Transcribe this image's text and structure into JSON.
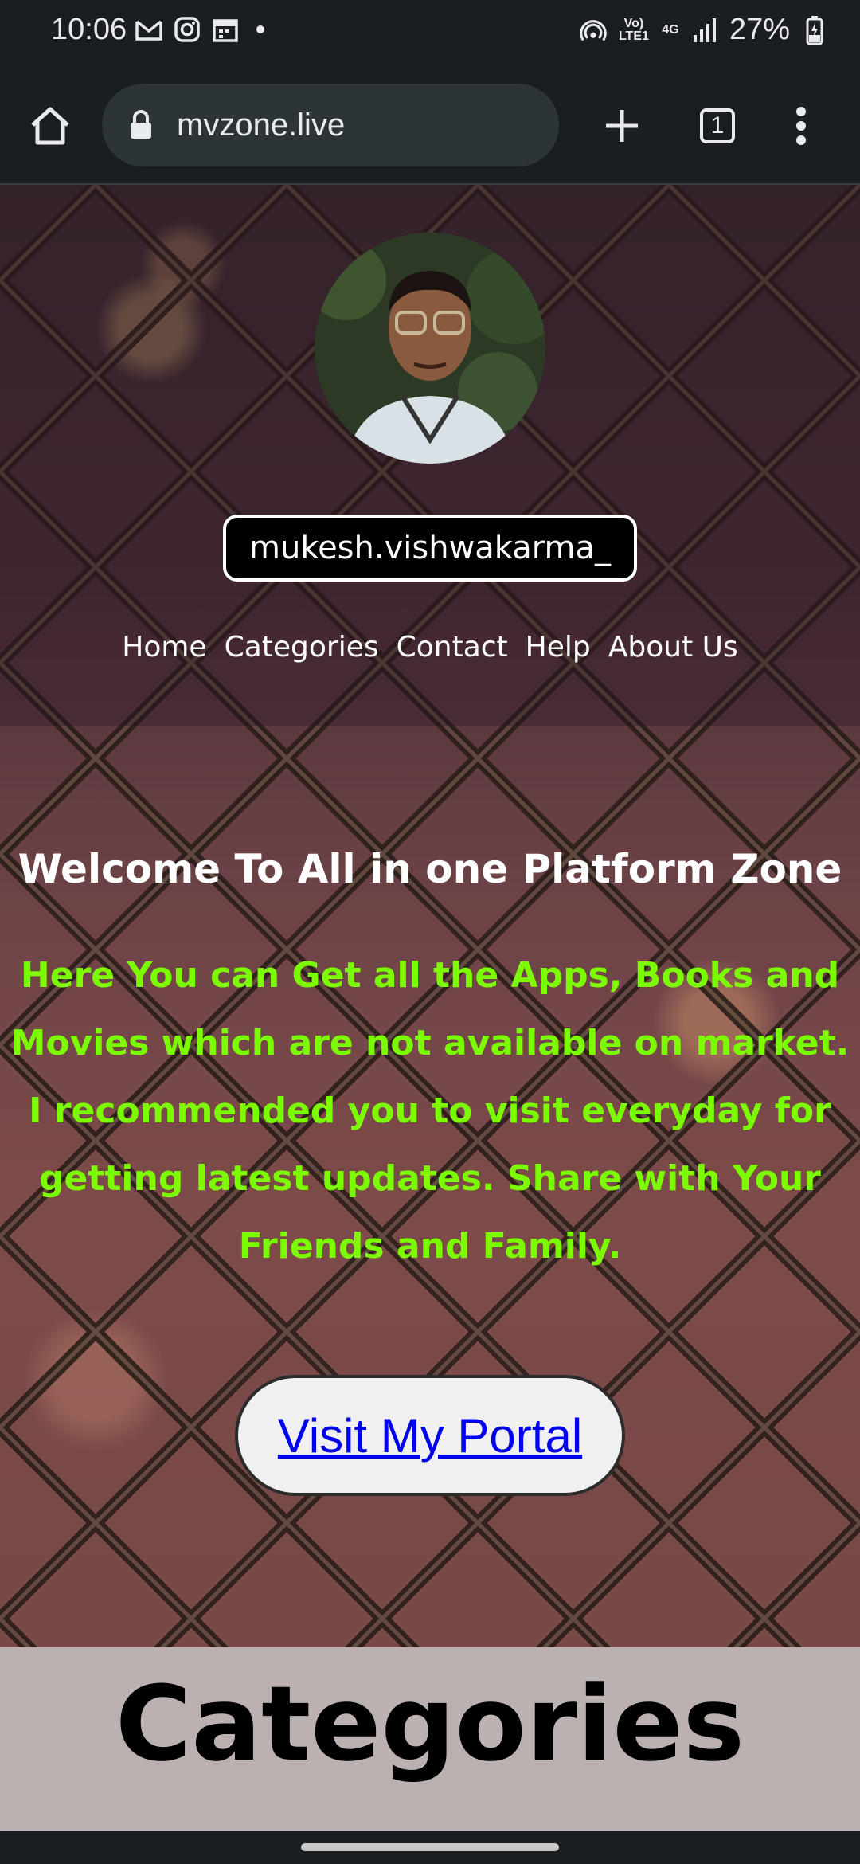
{
  "status_bar": {
    "time": "10:06",
    "battery": "27%",
    "volte_label": "Vo) LTE1",
    "network_label": "4G",
    "left_icons": [
      "gmail-icon",
      "instagram-icon",
      "calendar-icon"
    ],
    "right_icons": [
      "hotspot-icon",
      "volte-icon",
      "network-4g-icon",
      "signal-icon",
      "battery-charging-icon"
    ]
  },
  "browser": {
    "url": "mvzone.live",
    "tab_count": "1"
  },
  "page": {
    "username": "mukesh.vishwakarma_",
    "nav": [
      "Home",
      "Categories",
      "Contact",
      "Help",
      "About Us"
    ],
    "welcome_title": "Welcome To All in one Platform Zone",
    "welcome_body": "Here You can Get all the Apps, Books and Movies which are not available on market. I recommended you to visit everyday for getting latest updates. Share with Your Friends and Family.",
    "portal_button": "Visit My Portal",
    "categories_heading": "Categories"
  },
  "colors": {
    "welcome_body": "#7cfc00",
    "link": "#0000ee",
    "categories_bg": "#bcb1b1"
  }
}
